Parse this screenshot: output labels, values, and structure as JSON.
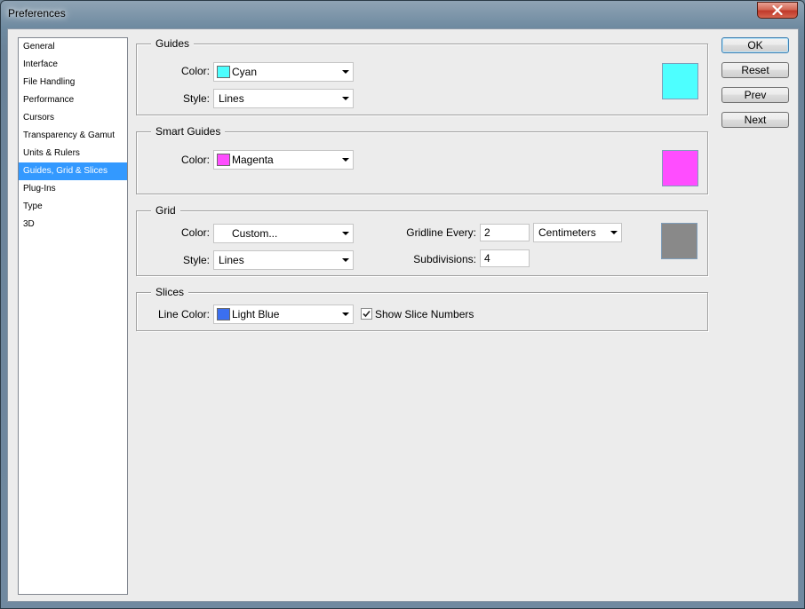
{
  "window": {
    "title": "Preferences"
  },
  "sidebar": {
    "items": [
      {
        "label": "General"
      },
      {
        "label": "Interface"
      },
      {
        "label": "File Handling"
      },
      {
        "label": "Performance"
      },
      {
        "label": "Cursors"
      },
      {
        "label": "Transparency & Gamut"
      },
      {
        "label": "Units & Rulers"
      },
      {
        "label": "Guides, Grid & Slices",
        "selected": true
      },
      {
        "label": "Plug-Ins"
      },
      {
        "label": "Type"
      },
      {
        "label": "3D"
      }
    ]
  },
  "guides": {
    "title": "Guides",
    "color_label": "Color:",
    "color_value": "Cyan",
    "color_hex": "#4dffff",
    "style_label": "Style:",
    "style_value": "Lines"
  },
  "smart_guides": {
    "title": "Smart Guides",
    "color_label": "Color:",
    "color_value": "Magenta",
    "color_hex": "#ff4dff"
  },
  "grid": {
    "title": "Grid",
    "color_label": "Color:",
    "color_value": "Custom...",
    "color_hex": "#898989",
    "style_label": "Style:",
    "style_value": "Lines",
    "gridline_label": "Gridline Every:",
    "gridline_value": "2",
    "unit_value": "Centimeters",
    "subdivisions_label": "Subdivisions:",
    "subdivisions_value": "4"
  },
  "slices": {
    "title": "Slices",
    "line_color_label": "Line Color:",
    "line_color_value": "Light Blue",
    "line_color_hex": "#3b6ff0",
    "show_numbers_label": "Show Slice Numbers",
    "show_numbers_checked": true
  },
  "buttons": {
    "ok": "OK",
    "reset": "Reset",
    "prev": "Prev",
    "next": "Next"
  },
  "colors": {
    "selection": "#3399ff",
    "dialog_bg": "#ececec"
  }
}
